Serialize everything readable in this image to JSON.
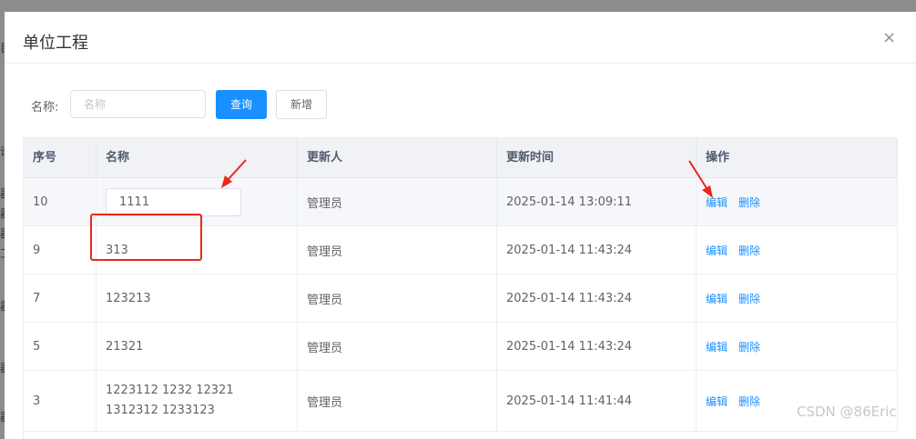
{
  "backdrop": {
    "fragments": [
      "目",
      "论",
      "器",
      "器",
      "器",
      "工",
      "器",
      "器",
      "器"
    ]
  },
  "dialog": {
    "title": "单位工程",
    "close_glyph": "×"
  },
  "search": {
    "label": "名称:",
    "placeholder": "名称",
    "value": "",
    "query_button": "查询",
    "add_button": "新增"
  },
  "table": {
    "columns": [
      "序号",
      "名称",
      "更新人",
      "更新时间",
      "操作"
    ],
    "rows": [
      {
        "index": "10",
        "name": "1111",
        "editing": true,
        "updater": "管理员",
        "updated_at": "2025-01-14 13:09:11",
        "edit": "编辑",
        "delete": "删除"
      },
      {
        "index": "9",
        "name": "313",
        "editing": false,
        "updater": "管理员",
        "updated_at": "2025-01-14 11:43:24",
        "edit": "编辑",
        "delete": "删除"
      },
      {
        "index": "7",
        "name": "123213",
        "editing": false,
        "updater": "管理员",
        "updated_at": "2025-01-14 11:43:24",
        "edit": "编辑",
        "delete": "删除"
      },
      {
        "index": "5",
        "name": "21321",
        "editing": false,
        "updater": "管理员",
        "updated_at": "2025-01-14 11:43:24",
        "edit": "编辑",
        "delete": "删除"
      },
      {
        "index": "3",
        "name": "1223112 1232 12321 1312312 1233123",
        "editing": false,
        "updater": "管理员",
        "updated_at": "2025-01-14 11:41:44",
        "edit": "编辑",
        "delete": "删除"
      }
    ]
  },
  "annotations": {
    "color": "#e8291c"
  },
  "watermark": "CSDN @86Eric"
}
